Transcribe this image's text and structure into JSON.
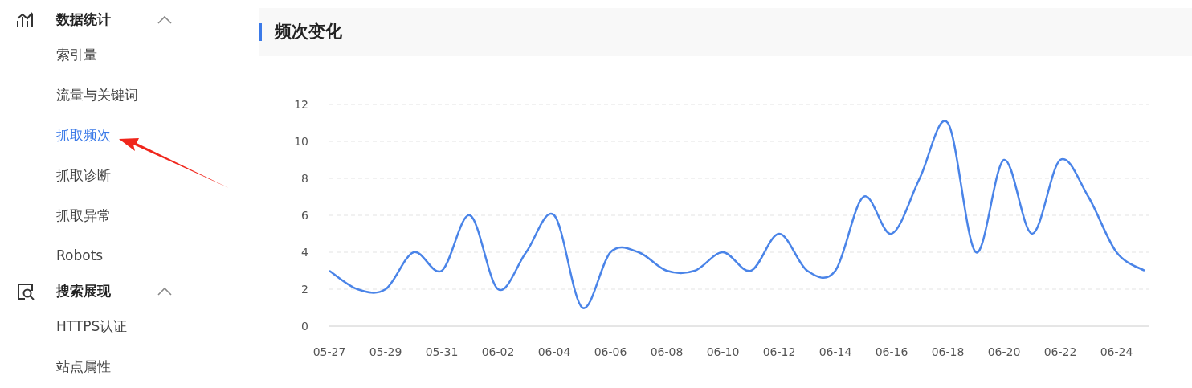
{
  "sidebar": {
    "groups": [
      {
        "title": "数据统计",
        "kind": "chart",
        "expanded": true,
        "items": [
          {
            "label": "索引量",
            "selected": false
          },
          {
            "label": "流量与关键词",
            "selected": false
          },
          {
            "label": "抓取频次",
            "selected": true
          },
          {
            "label": "抓取诊断",
            "selected": false
          },
          {
            "label": "抓取异常",
            "selected": false
          },
          {
            "label": "Robots",
            "selected": false
          }
        ]
      },
      {
        "title": "搜索展现",
        "kind": "search",
        "expanded": true,
        "items": [
          {
            "label": "HTTPS认证",
            "selected": false
          },
          {
            "label": "站点属性",
            "selected": false
          }
        ]
      }
    ]
  },
  "section": {
    "title": "频次变化"
  },
  "chart_data": {
    "type": "line",
    "grid": true,
    "categories": [
      "05-27",
      null,
      "05-29",
      null,
      "05-31",
      null,
      "06-02",
      null,
      "06-04",
      null,
      "06-06",
      null,
      "06-08",
      null,
      "06-10",
      null,
      "06-12",
      null,
      "06-14",
      null,
      "06-16",
      null,
      "06-18",
      null,
      "06-20",
      null,
      "06-22",
      null,
      "06-24",
      null
    ],
    "series": [
      {
        "color": "#4a84e8",
        "values": [
          3,
          2,
          2,
          4,
          3,
          6,
          2,
          4,
          6,
          1,
          4,
          4,
          3,
          3,
          4,
          3,
          5,
          3,
          3,
          7,
          5,
          8,
          11,
          4,
          9,
          5,
          9,
          7,
          4,
          3
        ]
      }
    ],
    "ylim": [
      0,
      12
    ],
    "yticks": [
      0,
      2,
      4,
      6,
      8,
      10,
      12
    ]
  }
}
